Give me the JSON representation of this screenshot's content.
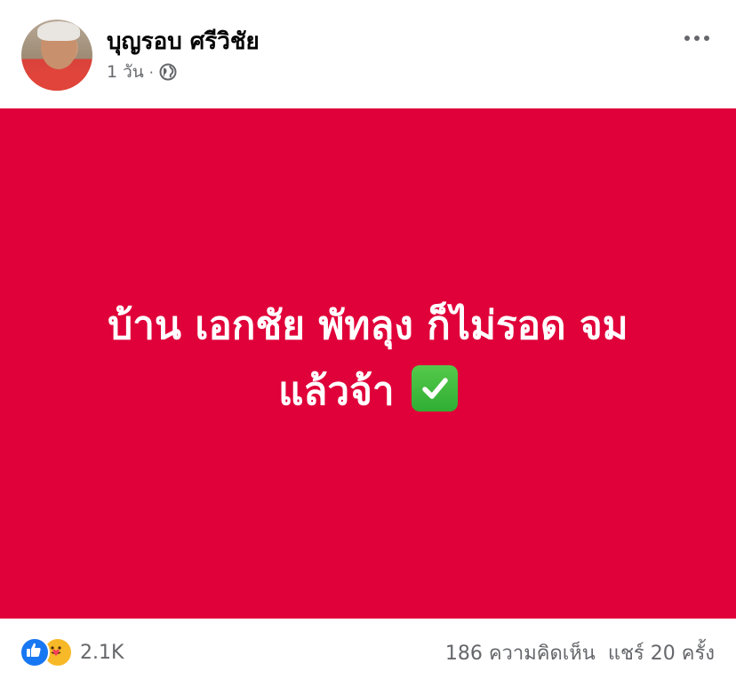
{
  "post": {
    "author": "บุญรอบ ศรีวิชัย",
    "timestamp": "1 วัน",
    "separator": "·",
    "privacy_icon": "globe-icon",
    "more_icon": "more-horizontal-icon",
    "background_color": "#e0003a",
    "status_lines": [
      "บ้าน เอกชัย พัทลุง ก็ไม่รอด จม",
      "แล้วจ้า"
    ],
    "status_emoji": "check-mark-button-icon"
  },
  "footer": {
    "reaction_icons": [
      "like-icon",
      "care-icon"
    ],
    "reaction_count": "2.1K",
    "comments": "186 ความคิดเห็น",
    "shares": "แชร์ 20 ครั้ง"
  }
}
